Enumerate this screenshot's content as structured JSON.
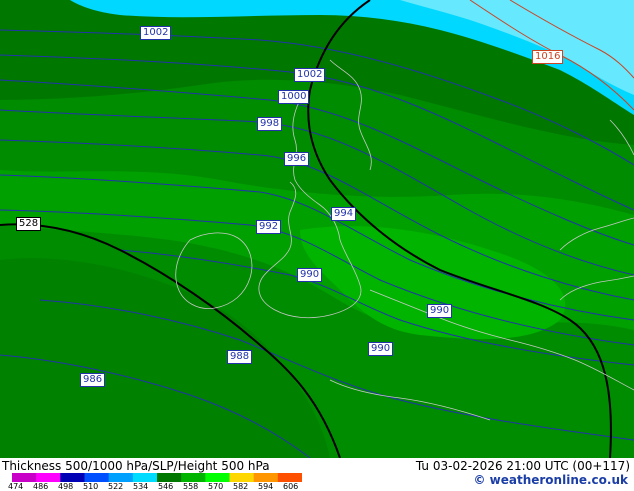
{
  "map": {
    "isobar_labels": [
      {
        "text": "1002",
        "color": "blue"
      },
      {
        "text": "1002",
        "color": "blue"
      },
      {
        "text": "1000",
        "color": "blue"
      },
      {
        "text": "998",
        "color": "blue"
      },
      {
        "text": "996",
        "color": "blue"
      },
      {
        "text": "994",
        "color": "blue"
      },
      {
        "text": "992",
        "color": "blue"
      },
      {
        "text": "990",
        "color": "blue"
      },
      {
        "text": "990",
        "color": "blue"
      },
      {
        "text": "990",
        "color": "blue"
      },
      {
        "text": "988",
        "color": "blue"
      },
      {
        "text": "986",
        "color": "blue"
      },
      {
        "text": "1016",
        "color": "red"
      }
    ],
    "height_label": "528",
    "colors": {
      "dark_green": "#007800",
      "mid_green": "#008c00",
      "green": "#00a000",
      "light_green": "#00b400",
      "cyan": "#00d8ff",
      "light_cyan": "#66e8ff",
      "isobar_blue": "#2233aa",
      "isobar_red": "#cc4422",
      "coastline": "#c8c8c8",
      "height_line": "#000000"
    }
  },
  "footer": {
    "title": "Thickness 500/1000 hPa/SLP/Height 500 hPa",
    "datetime": "Tu 03-02-2026 21:00 UTC (00+117)",
    "credit": "© weatheronline.co.uk",
    "scale_labels": [
      "474",
      "486",
      "498",
      "510",
      "522",
      "534",
      "546",
      "558",
      "570",
      "582",
      "594",
      "606"
    ],
    "scale_colors": [
      "#c800c8",
      "#ff00ff",
      "#0000b4",
      "#0050ff",
      "#00a0ff",
      "#00dcff",
      "#007800",
      "#00b400",
      "#00ff00",
      "#ffd700",
      "#ff9600",
      "#ff5000"
    ]
  }
}
